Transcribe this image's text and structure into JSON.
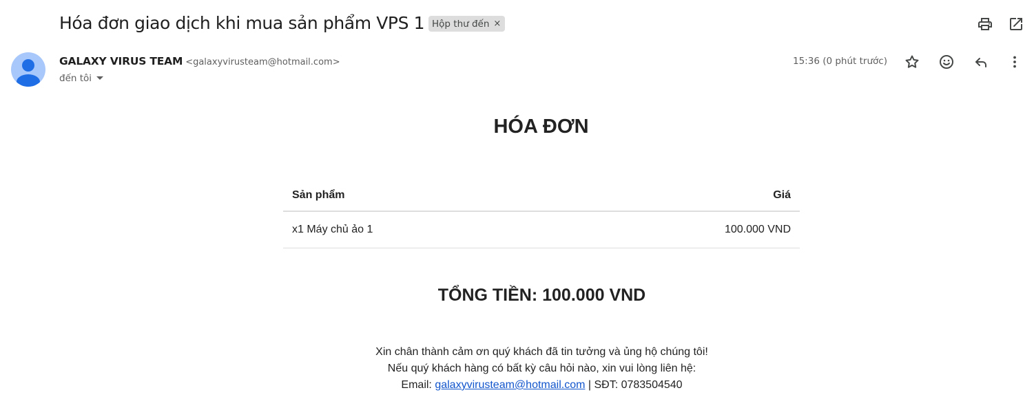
{
  "email": {
    "subject": "Hóa đơn giao dịch khi mua sản phẩm VPS 1",
    "label": "Hộp thư đến",
    "label_remove": "×",
    "sender_name": "GALAXY VIRUS TEAM",
    "sender_email": "<galaxyvirusteam@hotmail.com>",
    "to_text": "đến tôi",
    "time": "15:36 (0 phút trước)"
  },
  "icons": {
    "print": "print-icon",
    "open_new_window": "open-in-new-window-icon",
    "star": "star-icon",
    "emoji": "emoji-icon",
    "reply": "reply-icon",
    "more": "more-vertical-icon",
    "avatar": "default-avatar-icon"
  },
  "invoice": {
    "title": "HÓA ĐƠN",
    "columns": [
      "Sản phẩm",
      "Giá"
    ],
    "rows": [
      [
        "x1 Máy chủ ảo 1",
        "100.000 VND"
      ]
    ],
    "total": "TỔNG TIỀN: 100.000 VND",
    "thanks": "Xin chân thành cảm ơn quý khách đã tin tưởng và ủng hộ chúng tôi!",
    "contact_prompt": "Nếu quý khách hàng có bất kỳ câu hỏi nào, xin vui lòng liên hệ:",
    "email_label": "Email: ",
    "email_link": "galaxyvirusteam@hotmail.com",
    "phone": " | SĐT: 0783504540"
  },
  "colors": {
    "avatar_bg": "#a8c7fa",
    "avatar_fg": "#1f6ee6",
    "link": "#1155cc",
    "chip_bg": "#dddddd"
  }
}
